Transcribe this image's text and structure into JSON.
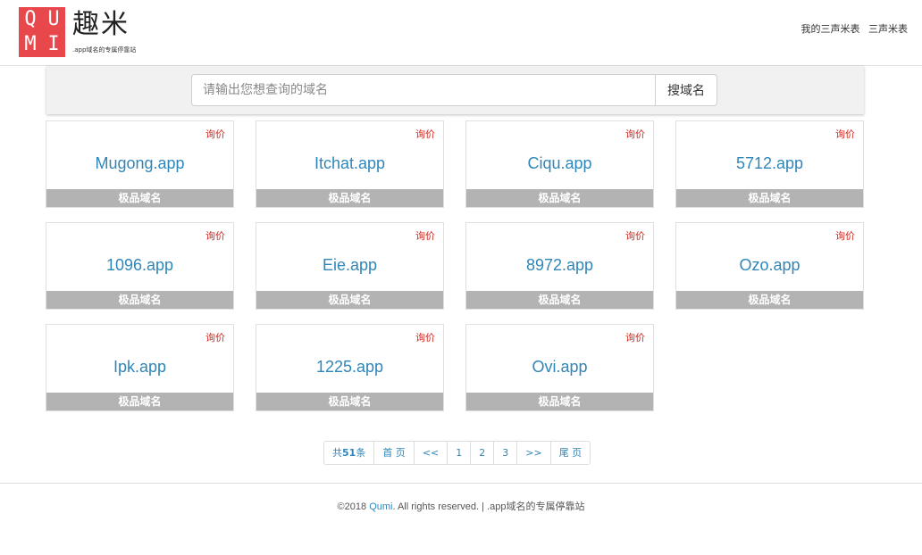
{
  "header": {
    "logo_letters": [
      "Q",
      "U",
      "M",
      "I"
    ],
    "logo_cn": "趣米",
    "logo_sub": ".app域名的专属停靠站",
    "nav": [
      "我的三声米表",
      "三声米表"
    ]
  },
  "search": {
    "placeholder": "请输出您想查询的域名",
    "button": "搜域名"
  },
  "inquiry_label": "询价",
  "tag_label": "极品域名",
  "domains": [
    "Mugong.app",
    "Itchat.app",
    "Ciqu.app",
    "5712.app",
    "1096.app",
    "Eie.app",
    "8972.app",
    "Ozo.app",
    "Ipk.app",
    "1225.app",
    "Ovi.app"
  ],
  "pagination": {
    "total_prefix": "共",
    "total_count": "51",
    "total_suffix": "条",
    "first": "首 页",
    "prev": "<<",
    "pages": [
      "1",
      "2",
      "3"
    ],
    "next": ">>",
    "last": "尾 页"
  },
  "footer": {
    "copyright": "©2018 ",
    "brand": "Qumi",
    "rights": ". All rights reserved. | .app域名的专属停靠站"
  },
  "colors": {
    "logo_red": "#e8474b",
    "domain_blue": "#2f86b9",
    "inquiry_red": "#d0281f",
    "tag_gray": "#b3b3b3"
  }
}
